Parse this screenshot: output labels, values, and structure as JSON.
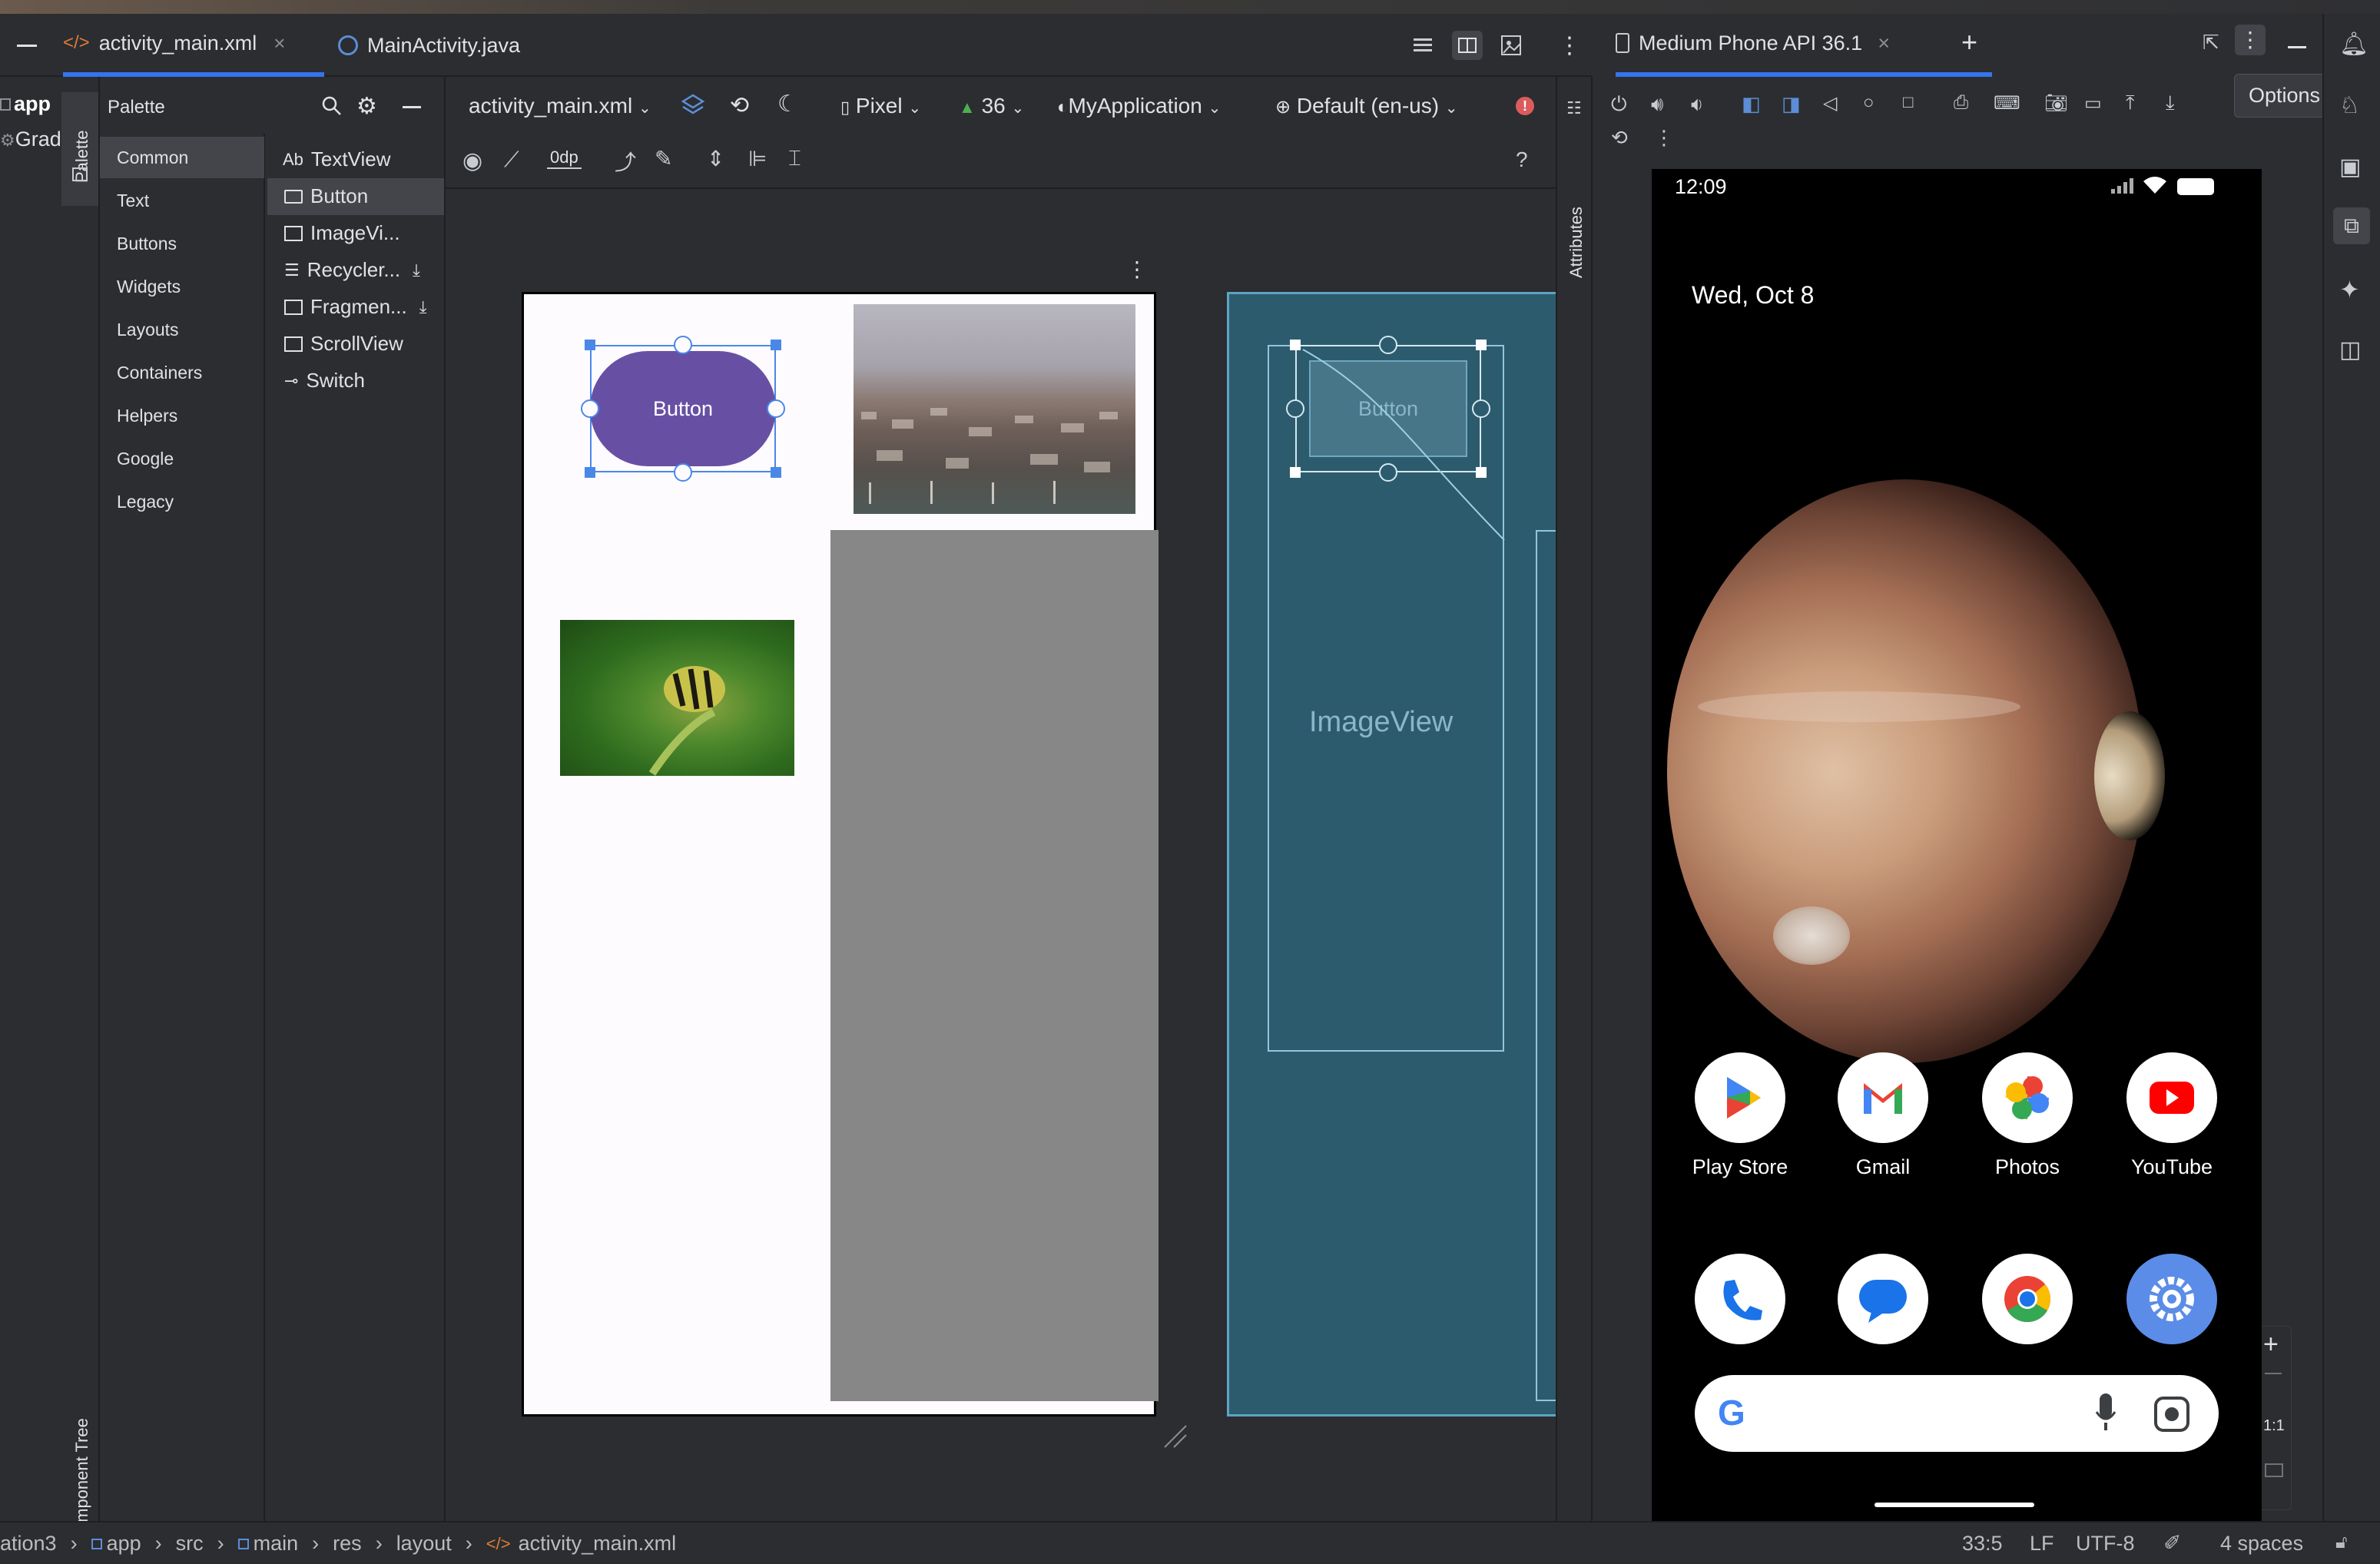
{
  "editor_tabs": [
    {
      "label": "activity_main.xml",
      "icon": "xml-icon",
      "active": true
    },
    {
      "label": "MainActivity.java",
      "icon": "java-class-icon",
      "active": false
    }
  ],
  "project": {
    "app_label": "app",
    "gradle_label": "Grad"
  },
  "side_tabs": {
    "palette": "Palette",
    "component_tree": "Component Tree",
    "attributes": "Attributes"
  },
  "palette": {
    "title": "Palette",
    "categories": [
      "Common",
      "Text",
      "Buttons",
      "Widgets",
      "Layouts",
      "Containers",
      "Helpers",
      "Google",
      "Legacy"
    ],
    "selected_category": "Common",
    "items": [
      {
        "label": "TextView",
        "prefix": "Ab"
      },
      {
        "label": "Button"
      },
      {
        "label": "ImageVi..."
      },
      {
        "label": "Recycler..."
      },
      {
        "label": "Fragmen..."
      },
      {
        "label": "ScrollView"
      },
      {
        "label": "Switch"
      }
    ],
    "selected_item": "Button"
  },
  "design_toolbar": {
    "file": "activity_main.xml",
    "device": "Pixel",
    "api": "36",
    "theme": "MyApplication",
    "locale": "Default (en-us)",
    "margin": "0dp"
  },
  "design": {
    "button_label": "Button",
    "blueprint_button_label": "Button",
    "blueprint_imageview_label": "ImageView"
  },
  "device_panel": {
    "tab_label": "Medium Phone API 36.1",
    "tooltip": "Options",
    "zoom_ratio": "1:1"
  },
  "phone": {
    "time": "12:09",
    "date": "Wed, Oct 8",
    "apps_row1": [
      {
        "label": "Play Store",
        "icon": "play-store-icon"
      },
      {
        "label": "Gmail",
        "icon": "gmail-icon"
      },
      {
        "label": "Photos",
        "icon": "photos-icon"
      },
      {
        "label": "YouTube",
        "icon": "youtube-icon"
      }
    ],
    "apps_row2": [
      {
        "icon": "phone-icon"
      },
      {
        "icon": "messages-icon"
      },
      {
        "icon": "chrome-icon"
      },
      {
        "icon": "settings-icon"
      }
    ],
    "search_logo": "G"
  },
  "status_bar": {
    "breadcrumb": [
      "ation3",
      "app",
      "src",
      "main",
      "res",
      "layout",
      "activity_main.xml"
    ],
    "position": "33:5",
    "line_sep": "LF",
    "encoding": "UTF-8",
    "indent": "4 spaces"
  },
  "colors": {
    "accent": "#3574f0",
    "button_purple": "#6750a4",
    "blueprint": "#2d5b6e"
  }
}
